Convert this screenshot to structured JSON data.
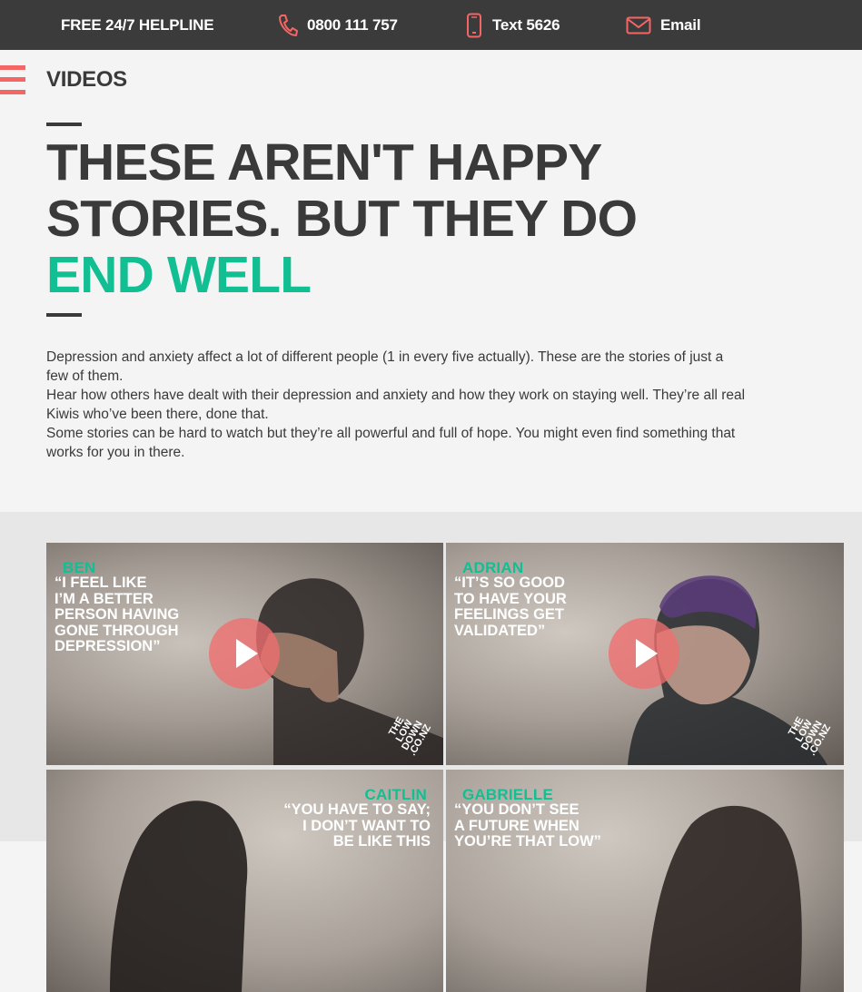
{
  "topbar": {
    "helpline": "FREE 24/7 HELPLINE",
    "phone": "0800 111 757",
    "text": "Text 5626",
    "email": "Email"
  },
  "header": {
    "page_label": "VIDEOS"
  },
  "hero": {
    "line1": "THESE AREN'T HAPPY",
    "line2": "STORIES. BUT THEY DO",
    "accent": "END WELL"
  },
  "intro": {
    "p1": "Depression and anxiety affect a lot of different people (1 in every five actually). These are the stories of just a few of them.",
    "p2": "Hear how others have dealt with their depression and anxiety and how they work on staying well. They’re all real Kiwis who’ve been there, done that.",
    "p3": "Some stories can be hard to watch but they’re all powerful and full of hope. You might even find something that works for you in there."
  },
  "videos": [
    {
      "name": "BEN",
      "quote": "“I FEEL LIKE\n I’M A BETTER\n PERSON HAVING\n GONE THROUGH\n DEPRESSION”"
    },
    {
      "name": "ADRIAN",
      "quote": "“IT’S SO GOOD\n TO HAVE YOUR\n FEELINGS GET\n VALIDATED”"
    },
    {
      "name": "CAITLIN",
      "quote": "“YOU HAVE TO SAY;\nI DON’T WANT TO\nBE LIKE THIS"
    },
    {
      "name": "GABRIELLE",
      "quote": "“YOU DON’T SEE\n A FUTURE WHEN\n YOU’RE THAT LOW”"
    }
  ],
  "logo": {
    "line1": "THE",
    "line2": "LOW",
    "line3": "DOWN",
    "line4": ".CO.NZ"
  },
  "colors": {
    "topbar_bg": "#3b3b3b",
    "accent_green": "#12bf93",
    "accent_red": "#f46666",
    "text_dark": "#3a3a3a",
    "page_bg": "#f4f4f4",
    "section_bg": "#e7e7e7"
  },
  "icons": {
    "phone": "phone-icon",
    "text": "mobile-icon",
    "email": "envelope-icon",
    "menu": "hamburger-icon",
    "play": "play-icon"
  }
}
